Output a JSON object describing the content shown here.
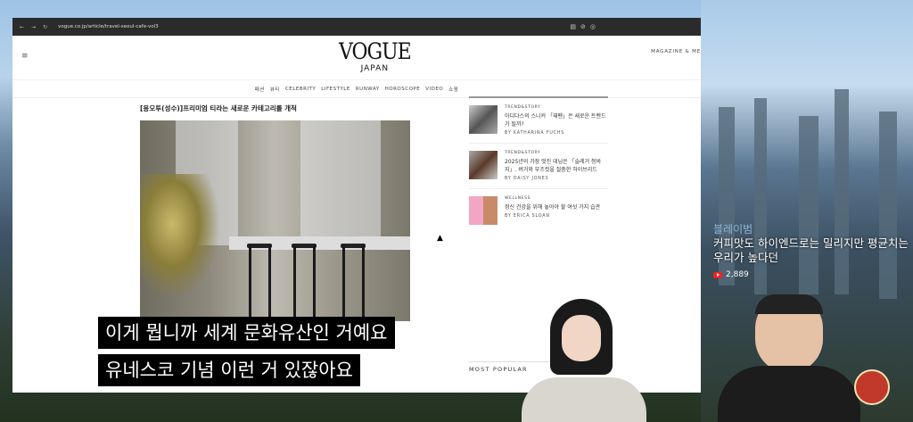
{
  "browser": {
    "url": "vogue.co.jp/article/travel-seoul-cafe-vol3"
  },
  "site": {
    "logo": "VOGUE",
    "logo_sub": "JAPAN",
    "magazine_link": "MAGAZINE & ME",
    "nav": [
      "패션",
      "뷰티",
      "CELEBRITY",
      "LIFESTYLE",
      "RUNWAY",
      "HOROSCOPE",
      "VIDEO",
      "쇼핑"
    ]
  },
  "article": {
    "title": "[용오투(성수)]프리미엄 티라는 새로운 카테고리를 개척"
  },
  "sidebar": {
    "cards": [
      {
        "category": "TREND&STORY",
        "title": "아디다스의 스니커 「재팬」은 새로운 트렌드가 될까?",
        "author": "BY KATHARINA FUCHS"
      },
      {
        "category": "TREND&STORY",
        "title": "2025년의 가장 멋진 데님은 「슬레거 청바지」. 버거와 부츠컷을 절충한 하이브리드",
        "author": "BY DAISY JONES"
      },
      {
        "category": "WELLNESS",
        "title": "정신 건강을 위해 놓아야 할 여섯 가지 습관",
        "author": "BY ERICA SLOAN"
      }
    ],
    "most_popular": "MOST POPULAR"
  },
  "subtitles": [
    "이게 뭡니까 세계 문화유산인 거예요",
    "유네스코 기념 이런 거 있잖아요"
  ],
  "overlay": {
    "channel": "블레이범",
    "text": "커피맛도 하이엔드로는 밀리지만 평균치는 우리가 높다던",
    "views": "2,889"
  }
}
